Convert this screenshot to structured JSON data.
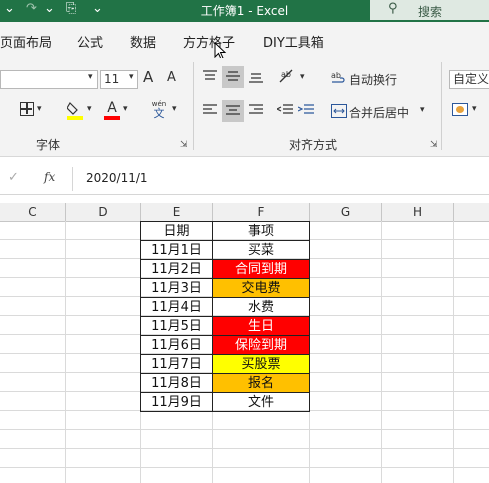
{
  "titlebar": {
    "title": "工作簿1  -  Excel",
    "search_placeholder": "搜索",
    "search_icon": "⚲",
    "redo_icon": "↷",
    "touch_icon": "⎘",
    "qat_more_icon": "⌄"
  },
  "tabs": [
    "页面布局",
    "公式",
    "数据",
    "方方格子",
    "DIY工具箱"
  ],
  "ribbon": {
    "font_size": "11",
    "grow_font": "A",
    "shrink_font": "A",
    "font_group": "字体",
    "wrap_text": "自动换行",
    "merge_center": "合并后居中",
    "align_group": "对齐方式",
    "number_format": "自定义",
    "wen_label": "wén",
    "wen_char": "文"
  },
  "formula_bar": {
    "cancel_icon": "✓",
    "fx_label": "fx",
    "value": "2020/11/1"
  },
  "columns": [
    "C",
    "D",
    "E",
    "F",
    "G",
    "H"
  ],
  "colors": {
    "title_green": "#217346",
    "red": "#ff0000",
    "orange": "#ffc000",
    "yellow": "#ffff00"
  },
  "table": {
    "headers": [
      "日期",
      "事项"
    ],
    "rows": [
      {
        "date": "11月1日",
        "item": "买菜",
        "fill": "none"
      },
      {
        "date": "11月2日",
        "item": "合同到期",
        "fill": "red"
      },
      {
        "date": "11月3日",
        "item": "交电费",
        "fill": "orange"
      },
      {
        "date": "11月4日",
        "item": "水费",
        "fill": "none"
      },
      {
        "date": "11月5日",
        "item": "生日",
        "fill": "red"
      },
      {
        "date": "11月6日",
        "item": "保险到期",
        "fill": "red"
      },
      {
        "date": "11月7日",
        "item": "买股票",
        "fill": "yellow"
      },
      {
        "date": "11月8日",
        "item": "报名",
        "fill": "orange"
      },
      {
        "date": "11月9日",
        "item": "文件",
        "fill": "none"
      }
    ]
  }
}
